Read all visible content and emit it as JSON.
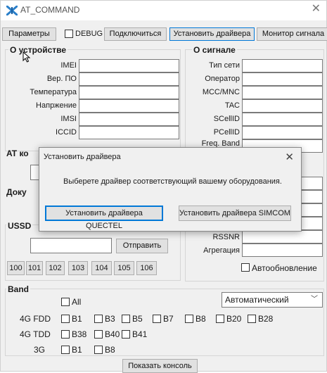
{
  "window": {
    "title": "AT_COMMAND"
  },
  "toolbar": {
    "params": "Параметры",
    "debug": "DEBUG",
    "connect": "Подключиться",
    "install_drivers": "Установить драйвера",
    "signal_monitor": "Монитор сигнала"
  },
  "device": {
    "header": "О устройстве",
    "rows": [
      "IMEI",
      "Вер. ПО",
      "Температура",
      "Напржение",
      "IMSI",
      "ICCID"
    ]
  },
  "signal": {
    "header": "О сигнале",
    "rows": [
      "Тип сети",
      "Оператор",
      "MCC/MNC",
      "TAC",
      "SCellID",
      "PCellID",
      "Freq. Band"
    ],
    "lower_rows": [
      "RSSNR",
      "Агрегация"
    ],
    "autoupdate": "Автообновление"
  },
  "at": {
    "header": "AT ко"
  },
  "docs": {
    "header": "Доку"
  },
  "ussd": {
    "header": "USSD",
    "send": "Отправить",
    "codes": [
      "100",
      "101",
      "102",
      "103",
      "104",
      "105",
      "106"
    ]
  },
  "band": {
    "header": "Band",
    "all": "All",
    "mode": "Автоматический",
    "fdd_label": "4G FDD",
    "fdd": [
      "B1",
      "B3",
      "B5",
      "B7",
      "B8",
      "B20",
      "B28"
    ],
    "tdd_label": "4G TDD",
    "tdd": [
      "B38",
      "B40",
      "B41"
    ],
    "g3_label": "3G",
    "g3": [
      "B1",
      "B8"
    ]
  },
  "console_button": "Показать консоль",
  "dialog": {
    "title": "Установить драйвера",
    "message": "Выберете драйвер соответствующий вашему оборудования.",
    "quectel": "Установить драйвера QUECTEL",
    "simcom": "Установить драйвера SIMCOM"
  },
  "colors": {
    "accent": "#0078d7",
    "window_bg": "#f0f0f0",
    "button_bg": "#e1e1e1"
  }
}
